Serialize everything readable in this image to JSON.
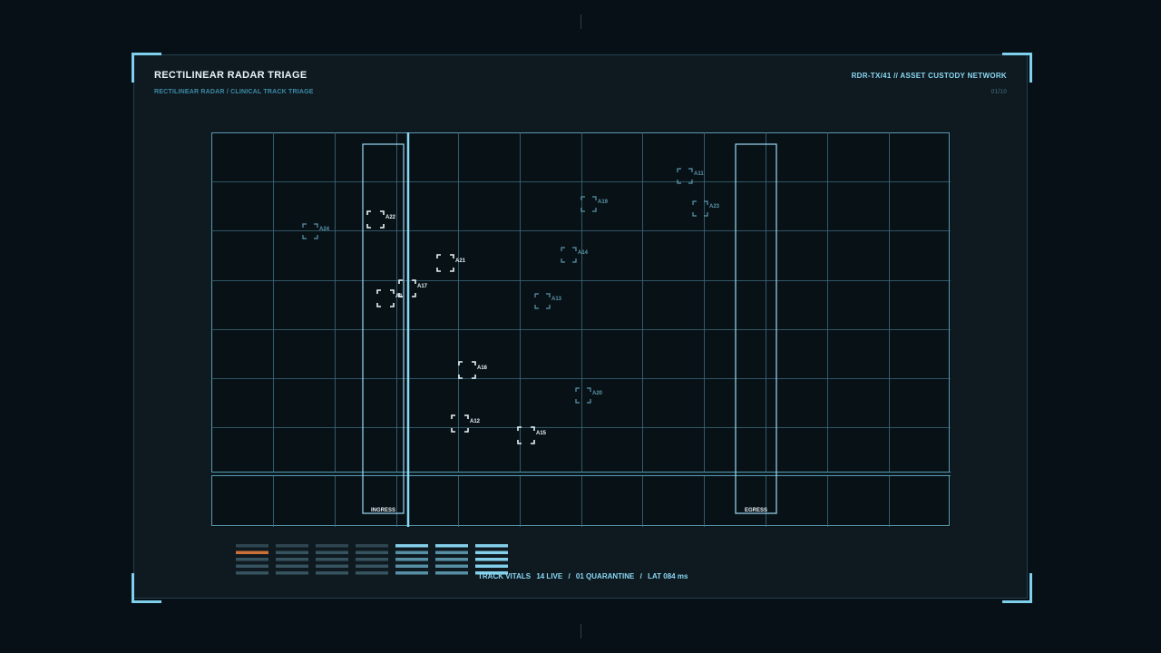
{
  "header": {
    "title": "RECTILINEAR RADAR TRIAGE",
    "subtitle": "RECTILINEAR RADAR / CLINICAL TRACK TRIAGE",
    "ident": "RDR-TX/41  //  ASSET CUSTODY NETWORK",
    "page": "01/10"
  },
  "zones": {
    "ingress": "INGRESS",
    "egress": "EGRESS"
  },
  "tracks": [
    {
      "id": "A11",
      "state": "dim"
    },
    {
      "id": "A19",
      "state": "dim"
    },
    {
      "id": "A23",
      "state": "dim"
    },
    {
      "id": "A22",
      "state": "bright"
    },
    {
      "id": "A24",
      "state": "dim"
    },
    {
      "id": "A21",
      "state": "bright"
    },
    {
      "id": "A14",
      "state": "dim"
    },
    {
      "id": "A17",
      "state": "bright"
    },
    {
      "id": "A1",
      "state": "bright"
    },
    {
      "id": "A13",
      "state": "dim"
    },
    {
      "id": "A16",
      "state": "bright"
    },
    {
      "id": "A20",
      "state": "dim"
    },
    {
      "id": "A12",
      "state": "bright"
    },
    {
      "id": "A15",
      "state": "bright"
    }
  ],
  "vitals": {
    "label": "TRACK VITALS",
    "live": "14 LIVE",
    "sep1": "/",
    "quarantine": "01 QUARANTINE",
    "sep2": "/",
    "latency": "LAT 084 ms"
  },
  "colors": {
    "accent": "#8ad8f4",
    "grid": "#3e6e80",
    "track_bright": "#e7f4f9",
    "track_dim": "#5c97ad",
    "alert": "#e07a3c"
  }
}
